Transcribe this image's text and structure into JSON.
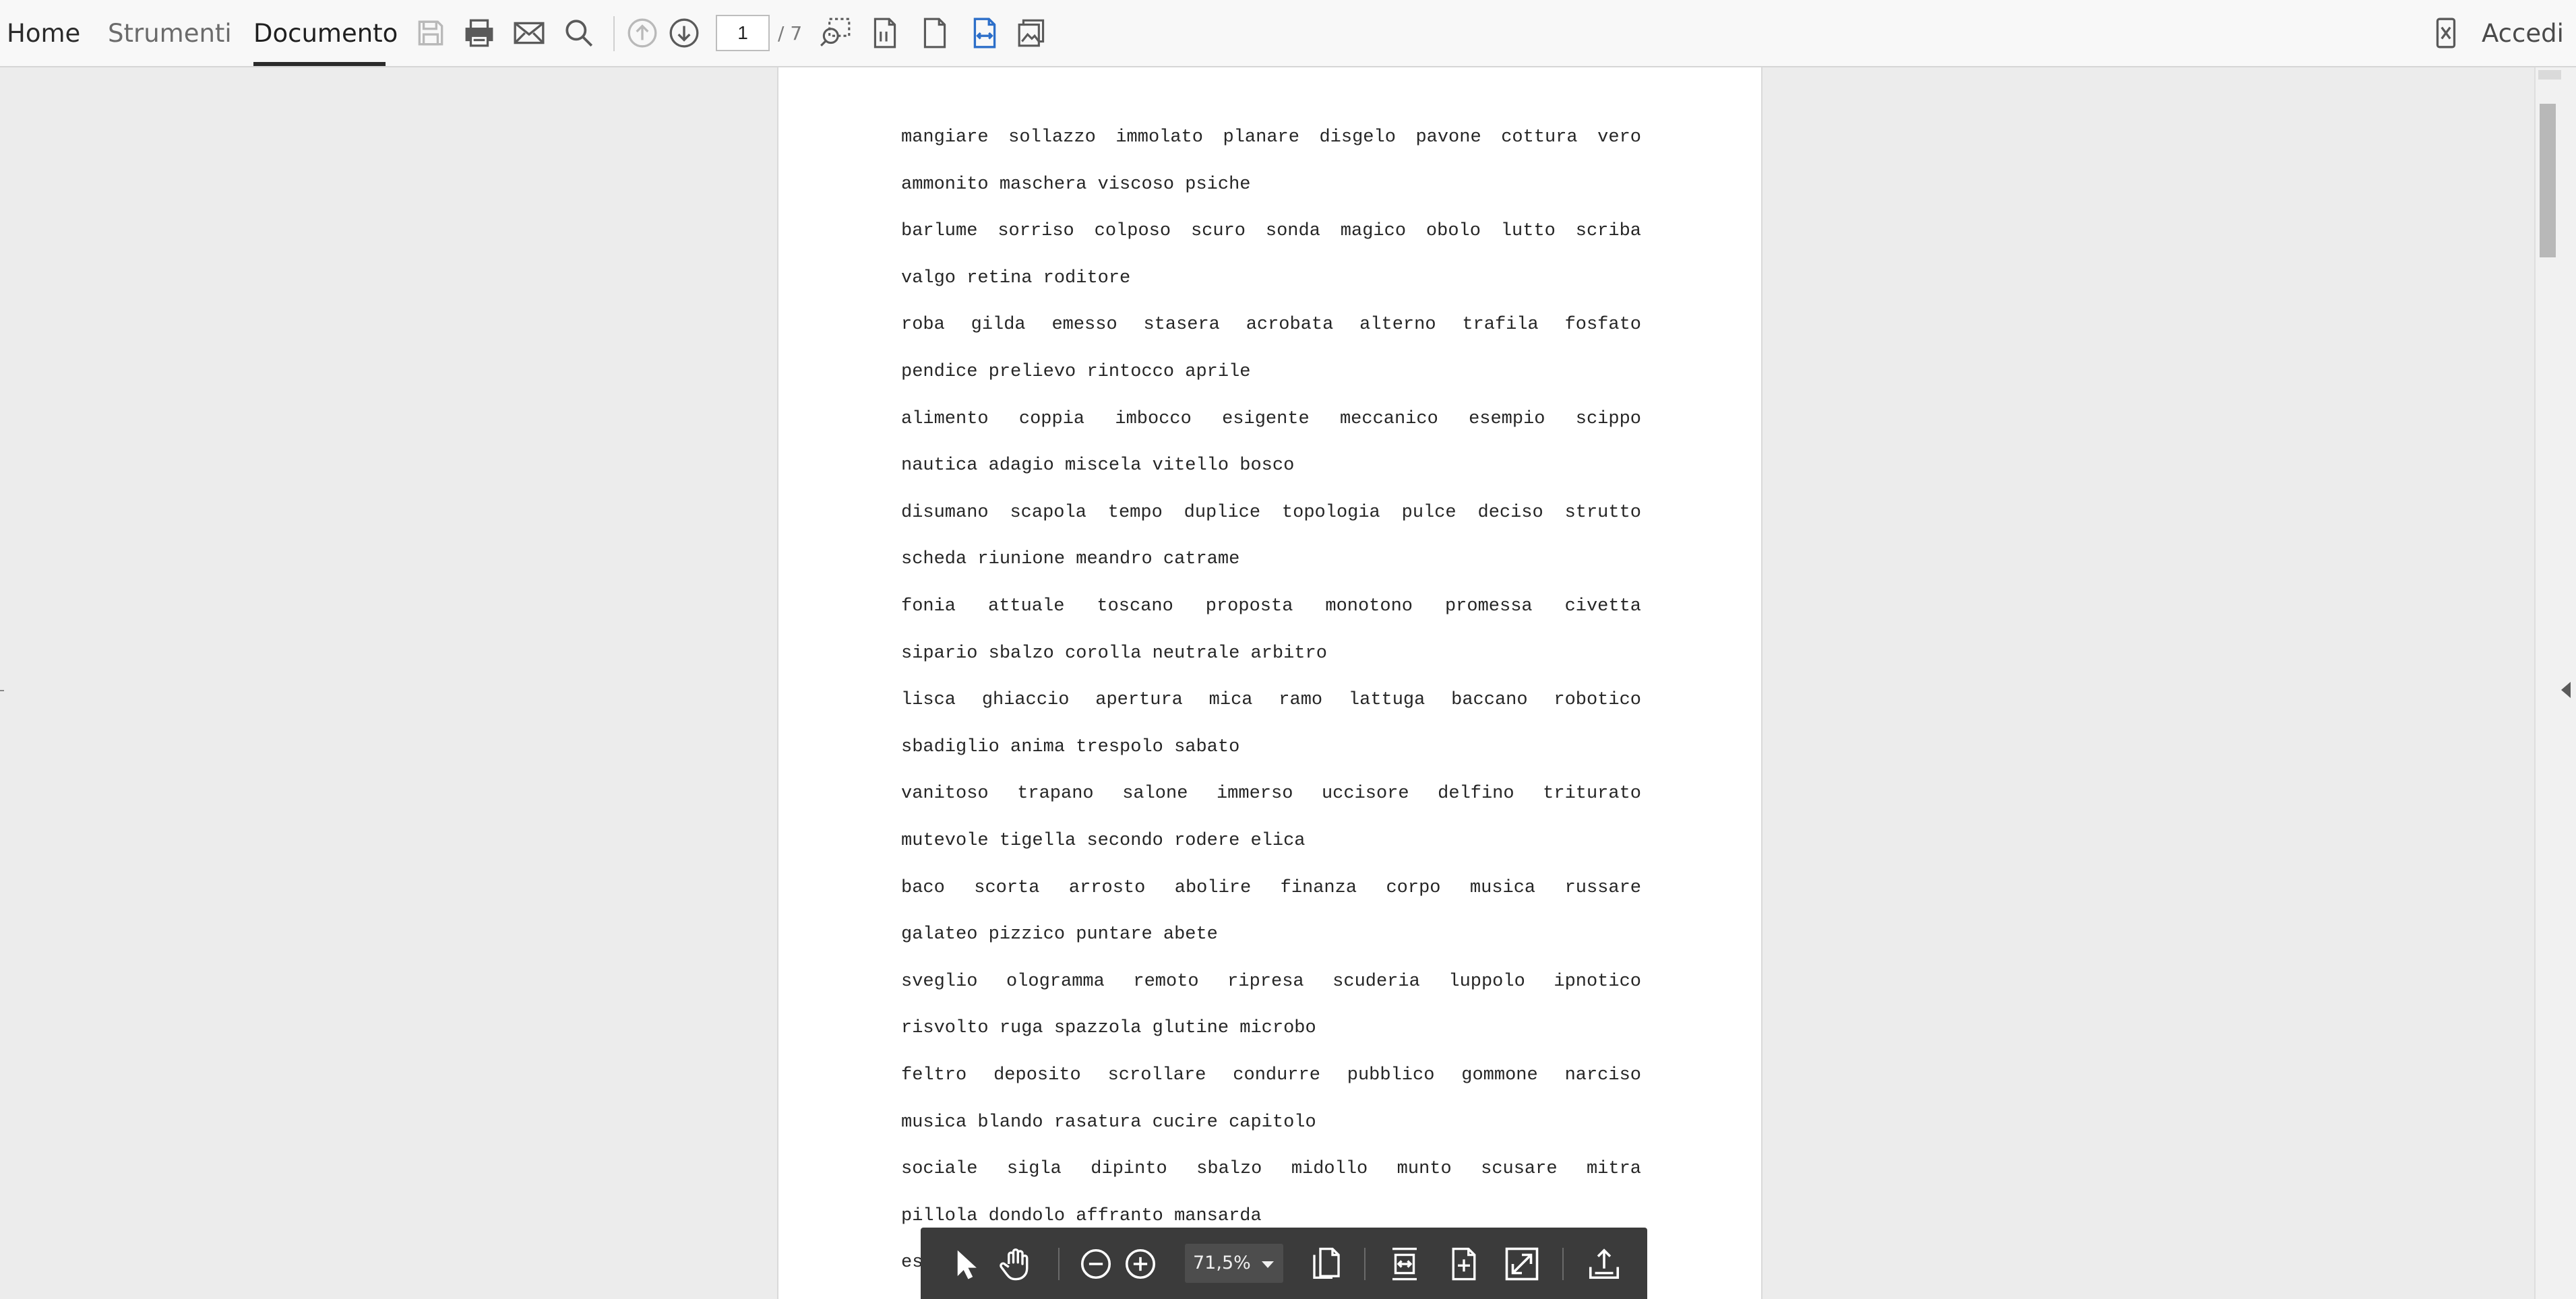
{
  "menu": {
    "home": "Home",
    "tools": "Strumenti",
    "document": "Documento"
  },
  "toolbar": {
    "page_current": "1",
    "page_total": "/ 7",
    "icons": [
      "save-icon",
      "print-icon",
      "email-icon",
      "search-icon",
      "previous-page-icon",
      "next-page-icon",
      "zoom-marquee-icon",
      "page-display-icon",
      "single-page-icon",
      "fit-width-icon",
      "image-pdf-icon"
    ]
  },
  "account": {
    "signin_label": "Accedi"
  },
  "document": {
    "lines": [
      "mangiare sollazzo immolato planare disgelo pavone cottura vero",
      "ammonito maschera viscoso psiche",
      "barlume sorriso colposo scuro sonda magico obolo lutto scriba",
      "valgo retina roditore",
      "roba gilda emesso stasera acrobata alterno trafila fosfato",
      "pendice prelievo rintocco aprile",
      "alimento coppia imbocco esigente meccanico esempio scippo",
      "nautica adagio miscela vitello bosco",
      "disumano scapola tempo duplice topologia pulce deciso strutto",
      "scheda riunione meandro catrame",
      "fonia attuale toscano proposta monotono promessa civetta",
      "sipario sbalzo corolla neutrale arbitro",
      "lisca ghiaccio apertura mica ramo lattuga baccano robotico",
      "sbadiglio anima trespolo sabato",
      "vanitoso trapano salone immerso uccisore delfino triturato",
      "mutevole tigella secondo rodere elica",
      "baco scorta arrosto abolire finanza corpo musica russare",
      "galateo pizzico puntare abete",
      "sveglio ologramma remoto ripresa scuderia luppolo ipnotico",
      "risvolto ruga spazzola glutine microbo",
      "feltro deposito scrollare condurre pubblico gommone narciso",
      "musica blando rasatura cucire capitolo",
      "sociale sigla dipinto sbalzo midollo munto scusare mitra",
      "pillola dondolo affranto mansarda",
      "es"
    ]
  },
  "floating_toolbar": {
    "zoom_value": "71,5%",
    "icons": [
      "select-cursor-icon",
      "hand-tool-icon",
      "zoom-out-icon",
      "zoom-in-icon",
      "rotate-page-icon",
      "fit-page-icon",
      "fit-visible-icon",
      "full-screen-icon",
      "share-upload-icon"
    ]
  },
  "colors": {
    "active_blue": "#2d6fc9",
    "icon_gray": "#5a5a5a",
    "disabled_gray": "#b9b9b9",
    "float_bar_bg": "#3b3b3b"
  }
}
